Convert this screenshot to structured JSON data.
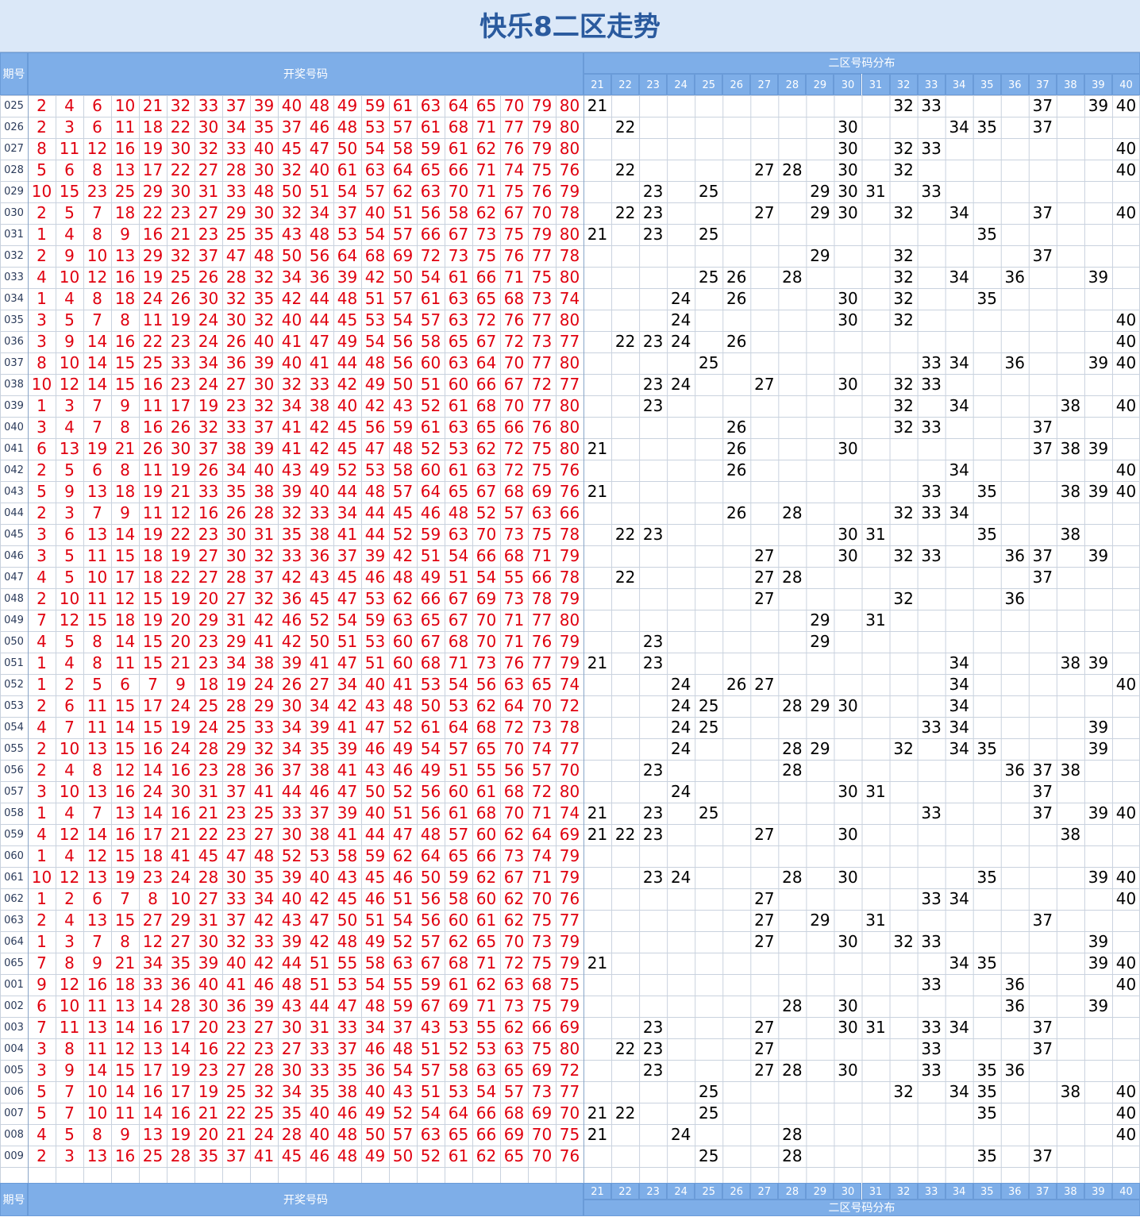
{
  "title": "快乐8二区走势",
  "header": {
    "period_label": "期号",
    "draw_label": "开奖号码",
    "dist_label": "二区号码分布",
    "zone_numbers": [
      "21",
      "22",
      "23",
      "24",
      "25",
      "26",
      "27",
      "28",
      "29",
      "30",
      "31",
      "32",
      "33",
      "34",
      "35",
      "36",
      "37",
      "38",
      "39",
      "40"
    ]
  },
  "colors": {
    "title": "#2a5a9e",
    "title_bg": "#dbe8f8",
    "header_bg": "#7eaee8",
    "draw_number": "#e0000f",
    "grid": "#c9d2de"
  },
  "chart_data": {
    "type": "table",
    "columns": [
      "期号",
      "开奖号码",
      "二区号码分布"
    ],
    "rows": [
      {
        "period": "025",
        "numbers": [
          2,
          4,
          6,
          10,
          21,
          32,
          33,
          37,
          39,
          40,
          48,
          49,
          59,
          61,
          63,
          64,
          65,
          70,
          79,
          80
        ]
      },
      {
        "period": "026",
        "numbers": [
          2,
          3,
          6,
          11,
          18,
          22,
          30,
          34,
          35,
          37,
          46,
          48,
          53,
          57,
          61,
          68,
          71,
          77,
          79,
          80
        ]
      },
      {
        "period": "027",
        "numbers": [
          8,
          11,
          12,
          16,
          19,
          30,
          32,
          33,
          40,
          45,
          47,
          50,
          54,
          58,
          59,
          61,
          62,
          76,
          79,
          80
        ]
      },
      {
        "period": "028",
        "numbers": [
          5,
          6,
          8,
          13,
          17,
          22,
          27,
          28,
          30,
          32,
          40,
          61,
          63,
          64,
          65,
          66,
          71,
          74,
          75,
          76
        ]
      },
      {
        "period": "029",
        "numbers": [
          10,
          15,
          23,
          25,
          29,
          30,
          31,
          33,
          48,
          50,
          51,
          54,
          57,
          62,
          63,
          70,
          71,
          75,
          76,
          79
        ]
      },
      {
        "period": "030",
        "numbers": [
          2,
          5,
          7,
          18,
          22,
          23,
          27,
          29,
          30,
          32,
          34,
          37,
          40,
          51,
          56,
          58,
          62,
          67,
          70,
          78
        ]
      },
      {
        "period": "031",
        "numbers": [
          1,
          4,
          8,
          9,
          16,
          21,
          23,
          25,
          35,
          43,
          48,
          53,
          54,
          57,
          66,
          67,
          73,
          75,
          79,
          80
        ]
      },
      {
        "period": "032",
        "numbers": [
          2,
          9,
          10,
          13,
          29,
          32,
          37,
          47,
          48,
          50,
          56,
          64,
          68,
          69,
          72,
          73,
          75,
          76,
          77,
          78
        ]
      },
      {
        "period": "033",
        "numbers": [
          4,
          10,
          12,
          16,
          19,
          25,
          26,
          28,
          32,
          34,
          36,
          39,
          42,
          50,
          54,
          61,
          66,
          71,
          75,
          80
        ]
      },
      {
        "period": "034",
        "numbers": [
          1,
          4,
          8,
          18,
          24,
          26,
          30,
          32,
          35,
          42,
          44,
          48,
          51,
          57,
          61,
          63,
          65,
          68,
          73,
          74
        ]
      },
      {
        "period": "035",
        "numbers": [
          3,
          5,
          7,
          8,
          11,
          19,
          24,
          30,
          32,
          40,
          44,
          45,
          53,
          54,
          57,
          63,
          72,
          76,
          77,
          80
        ]
      },
      {
        "period": "036",
        "numbers": [
          3,
          9,
          14,
          16,
          22,
          23,
          24,
          26,
          40,
          41,
          47,
          49,
          54,
          56,
          58,
          65,
          67,
          72,
          73,
          77
        ]
      },
      {
        "period": "037",
        "numbers": [
          8,
          10,
          14,
          15,
          25,
          33,
          34,
          36,
          39,
          40,
          41,
          44,
          48,
          56,
          60,
          63,
          64,
          70,
          77,
          80
        ]
      },
      {
        "period": "038",
        "numbers": [
          10,
          12,
          14,
          15,
          16,
          23,
          24,
          27,
          30,
          32,
          33,
          42,
          49,
          50,
          51,
          60,
          66,
          67,
          72,
          77
        ]
      },
      {
        "period": "039",
        "numbers": [
          1,
          3,
          7,
          9,
          11,
          17,
          19,
          23,
          32,
          34,
          38,
          40,
          42,
          43,
          52,
          61,
          68,
          70,
          77,
          80
        ]
      },
      {
        "period": "040",
        "numbers": [
          3,
          4,
          7,
          8,
          16,
          26,
          32,
          33,
          37,
          41,
          42,
          45,
          56,
          59,
          61,
          63,
          65,
          66,
          76,
          80
        ]
      },
      {
        "period": "041",
        "numbers": [
          6,
          13,
          19,
          21,
          26,
          30,
          37,
          38,
          39,
          41,
          42,
          45,
          47,
          48,
          52,
          53,
          62,
          72,
          75,
          80
        ]
      },
      {
        "period": "042",
        "numbers": [
          2,
          5,
          6,
          8,
          11,
          19,
          26,
          34,
          40,
          43,
          49,
          52,
          53,
          58,
          60,
          61,
          63,
          72,
          75,
          76
        ]
      },
      {
        "period": "043",
        "numbers": [
          5,
          9,
          13,
          18,
          19,
          21,
          33,
          35,
          38,
          39,
          40,
          44,
          48,
          57,
          64,
          65,
          67,
          68,
          69,
          76
        ]
      },
      {
        "period": "044",
        "numbers": [
          2,
          3,
          7,
          9,
          11,
          12,
          16,
          26,
          28,
          32,
          33,
          34,
          44,
          45,
          46,
          48,
          52,
          57,
          63,
          66
        ]
      },
      {
        "period": "045",
        "numbers": [
          3,
          6,
          13,
          14,
          19,
          22,
          23,
          30,
          31,
          35,
          38,
          41,
          44,
          52,
          59,
          63,
          70,
          73,
          75,
          78
        ]
      },
      {
        "period": "046",
        "numbers": [
          3,
          5,
          11,
          15,
          18,
          19,
          27,
          30,
          32,
          33,
          36,
          37,
          39,
          42,
          51,
          54,
          66,
          68,
          71,
          79
        ]
      },
      {
        "period": "047",
        "numbers": [
          4,
          5,
          10,
          17,
          18,
          22,
          27,
          28,
          37,
          42,
          43,
          45,
          46,
          48,
          49,
          51,
          54,
          55,
          66,
          78
        ]
      },
      {
        "period": "048",
        "numbers": [
          2,
          10,
          11,
          12,
          15,
          19,
          20,
          27,
          32,
          36,
          45,
          47,
          53,
          62,
          66,
          67,
          69,
          73,
          78,
          79
        ]
      },
      {
        "period": "049",
        "numbers": [
          7,
          12,
          15,
          18,
          19,
          20,
          29,
          31,
          42,
          46,
          52,
          54,
          59,
          63,
          65,
          67,
          70,
          71,
          77,
          80
        ]
      },
      {
        "period": "050",
        "numbers": [
          4,
          5,
          8,
          14,
          15,
          20,
          23,
          29,
          41,
          42,
          50,
          51,
          53,
          60,
          67,
          68,
          70,
          71,
          76,
          79
        ]
      },
      {
        "period": "051",
        "numbers": [
          1,
          4,
          8,
          11,
          15,
          21,
          23,
          34,
          38,
          39,
          41,
          47,
          51,
          60,
          68,
          71,
          73,
          76,
          77,
          79
        ]
      },
      {
        "period": "052",
        "numbers": [
          1,
          2,
          5,
          6,
          7,
          9,
          18,
          19,
          24,
          26,
          27,
          34,
          40,
          41,
          53,
          54,
          56,
          63,
          65,
          74
        ]
      },
      {
        "period": "053",
        "numbers": [
          2,
          6,
          11,
          15,
          17,
          24,
          25,
          28,
          29,
          30,
          34,
          42,
          43,
          48,
          50,
          53,
          62,
          64,
          70,
          72
        ]
      },
      {
        "period": "054",
        "numbers": [
          4,
          7,
          11,
          14,
          15,
          19,
          24,
          25,
          33,
          34,
          39,
          41,
          47,
          52,
          61,
          64,
          68,
          72,
          73,
          78
        ]
      },
      {
        "period": "055",
        "numbers": [
          2,
          10,
          13,
          15,
          16,
          24,
          28,
          29,
          32,
          34,
          35,
          39,
          46,
          49,
          54,
          57,
          65,
          70,
          74,
          77
        ]
      },
      {
        "period": "056",
        "numbers": [
          2,
          4,
          8,
          12,
          14,
          16,
          23,
          28,
          36,
          37,
          38,
          41,
          43,
          46,
          49,
          51,
          55,
          56,
          57,
          70
        ]
      },
      {
        "period": "057",
        "numbers": [
          3,
          10,
          13,
          16,
          24,
          30,
          31,
          37,
          41,
          44,
          46,
          47,
          50,
          52,
          56,
          60,
          61,
          68,
          72,
          80
        ]
      },
      {
        "period": "058",
        "numbers": [
          1,
          4,
          7,
          13,
          14,
          16,
          21,
          23,
          25,
          33,
          37,
          39,
          40,
          51,
          56,
          61,
          68,
          70,
          71,
          74
        ]
      },
      {
        "period": "059",
        "numbers": [
          4,
          12,
          14,
          16,
          17,
          21,
          22,
          23,
          27,
          30,
          38,
          41,
          44,
          47,
          48,
          57,
          60,
          62,
          64,
          69
        ]
      },
      {
        "period": "060",
        "numbers": [
          1,
          4,
          12,
          15,
          18,
          41,
          45,
          47,
          48,
          52,
          53,
          58,
          59,
          62,
          64,
          65,
          66,
          73,
          74,
          79
        ]
      },
      {
        "period": "061",
        "numbers": [
          10,
          12,
          13,
          19,
          23,
          24,
          28,
          30,
          35,
          39,
          40,
          43,
          45,
          46,
          50,
          59,
          62,
          67,
          71,
          79
        ]
      },
      {
        "period": "062",
        "numbers": [
          1,
          2,
          6,
          7,
          8,
          10,
          27,
          33,
          34,
          40,
          42,
          45,
          46,
          51,
          56,
          58,
          60,
          62,
          70,
          76
        ]
      },
      {
        "period": "063",
        "numbers": [
          2,
          4,
          13,
          15,
          27,
          29,
          31,
          37,
          42,
          43,
          47,
          50,
          51,
          54,
          56,
          60,
          61,
          62,
          75,
          77
        ]
      },
      {
        "period": "064",
        "numbers": [
          1,
          3,
          7,
          8,
          12,
          27,
          30,
          32,
          33,
          39,
          42,
          48,
          49,
          52,
          57,
          62,
          65,
          70,
          73,
          79
        ]
      },
      {
        "period": "065",
        "numbers": [
          7,
          8,
          9,
          21,
          34,
          35,
          39,
          40,
          42,
          44,
          51,
          55,
          58,
          63,
          67,
          68,
          71,
          72,
          75,
          79
        ]
      },
      {
        "period": "001",
        "numbers": [
          9,
          12,
          16,
          18,
          33,
          36,
          40,
          41,
          46,
          48,
          51,
          53,
          54,
          55,
          59,
          61,
          62,
          63,
          68,
          75
        ]
      },
      {
        "period": "002",
        "numbers": [
          6,
          10,
          11,
          13,
          14,
          28,
          30,
          36,
          39,
          43,
          44,
          47,
          48,
          59,
          67,
          69,
          71,
          73,
          75,
          79
        ]
      },
      {
        "period": "003",
        "numbers": [
          7,
          11,
          13,
          14,
          16,
          17,
          20,
          23,
          27,
          30,
          31,
          33,
          34,
          37,
          43,
          53,
          55,
          62,
          66,
          69
        ]
      },
      {
        "period": "004",
        "numbers": [
          3,
          8,
          11,
          12,
          13,
          14,
          16,
          22,
          23,
          27,
          33,
          37,
          46,
          48,
          51,
          52,
          53,
          63,
          75,
          80
        ]
      },
      {
        "period": "005",
        "numbers": [
          3,
          9,
          14,
          15,
          17,
          19,
          23,
          27,
          28,
          30,
          33,
          35,
          36,
          54,
          57,
          58,
          63,
          65,
          69,
          72
        ]
      },
      {
        "period": "006",
        "numbers": [
          5,
          7,
          10,
          14,
          16,
          17,
          19,
          25,
          32,
          34,
          35,
          38,
          40,
          43,
          51,
          53,
          54,
          57,
          73,
          77
        ]
      },
      {
        "period": "007",
        "numbers": [
          5,
          7,
          10,
          11,
          14,
          16,
          21,
          22,
          25,
          35,
          40,
          46,
          49,
          52,
          54,
          64,
          66,
          68,
          69,
          70
        ]
      },
      {
        "period": "008",
        "numbers": [
          4,
          5,
          8,
          9,
          13,
          19,
          20,
          21,
          24,
          28,
          40,
          48,
          50,
          57,
          63,
          65,
          66,
          69,
          70,
          75
        ]
      },
      {
        "period": "009",
        "numbers": [
          2,
          3,
          13,
          16,
          25,
          28,
          35,
          37,
          41,
          45,
          46,
          48,
          49,
          50,
          52,
          61,
          62,
          65,
          70,
          76
        ]
      }
    ]
  }
}
